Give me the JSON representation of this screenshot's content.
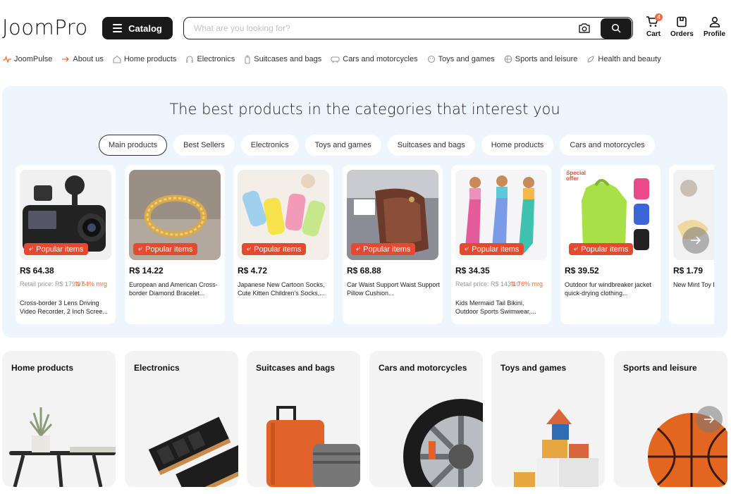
{
  "header": {
    "logo": "JoomPro",
    "catalog_label": "Catalog",
    "search_placeholder": "What are you looking for?",
    "cart": {
      "label": "Cart",
      "badge": "4"
    },
    "orders_label": "Orders",
    "profile_label": "Profile"
  },
  "nav": [
    {
      "label": "JoomPulse",
      "icon": "pulse-icon"
    },
    {
      "label": "About us",
      "icon": "arrow-right-icon"
    },
    {
      "label": "Home products",
      "icon": "home-icon"
    },
    {
      "label": "Electronics",
      "icon": "headphones-icon"
    },
    {
      "label": "Suitcases and bags",
      "icon": "suitcase-icon"
    },
    {
      "label": "Cars and motorcycles",
      "icon": "car-icon"
    },
    {
      "label": "Toys and games",
      "icon": "toy-icon"
    },
    {
      "label": "Sports and leisure",
      "icon": "ball-icon"
    },
    {
      "label": "Health and beauty",
      "icon": "beauty-icon"
    }
  ],
  "best": {
    "title": "The best products in the categories that interest you",
    "tabs": [
      "Main products",
      "Best Sellers",
      "Electronics",
      "Toys and games",
      "Suitcases and bags",
      "Home products",
      "Cars and motorcycles"
    ],
    "active_tab": "Main products",
    "badge_label": "Popular items",
    "products": [
      {
        "price": "R$ 64.38",
        "retail": "Retail price: R$ 179.97",
        "discount": "64% mrg",
        "desc": "Cross-border 3 Lens Driving Video Recorder, 2 Inch Scree..."
      },
      {
        "price": "R$ 14.22",
        "desc": "European and American Cross-border Diamond Bracelet..."
      },
      {
        "price": "R$ 4.72",
        "desc": "Japanese New Cartoon Socks, Cute Kitten Children's Socks,..."
      },
      {
        "price": "R$ 68.88",
        "desc": "Car Waist Support Waist Support Pillow Cushion..."
      },
      {
        "price": "R$ 34.35",
        "retail": "Retail price: R$ 143.10",
        "discount": "76% mrg",
        "desc": "Kids Mermaid Tail Bikini, Outdoor Sports Swimwear,..."
      },
      {
        "price": "R$ 39.52",
        "desc": "Outdoor fur windbreaker jacket quick-drying clothing...",
        "special": "Special offer"
      },
      {
        "price": "R$ 1.79",
        "desc": "New Mint Toy Herbal Mouse"
      }
    ]
  },
  "categories": [
    "Home products",
    "Electronics",
    "Suitcases and bags",
    "Cars and motorcycles",
    "Toys and games",
    "Sports and leisure"
  ],
  "colors": {
    "accent": "#f26b3a",
    "badge_red": "#e24b32",
    "panel_bg": "#edf5fd",
    "dark": "#1a1a1a"
  }
}
